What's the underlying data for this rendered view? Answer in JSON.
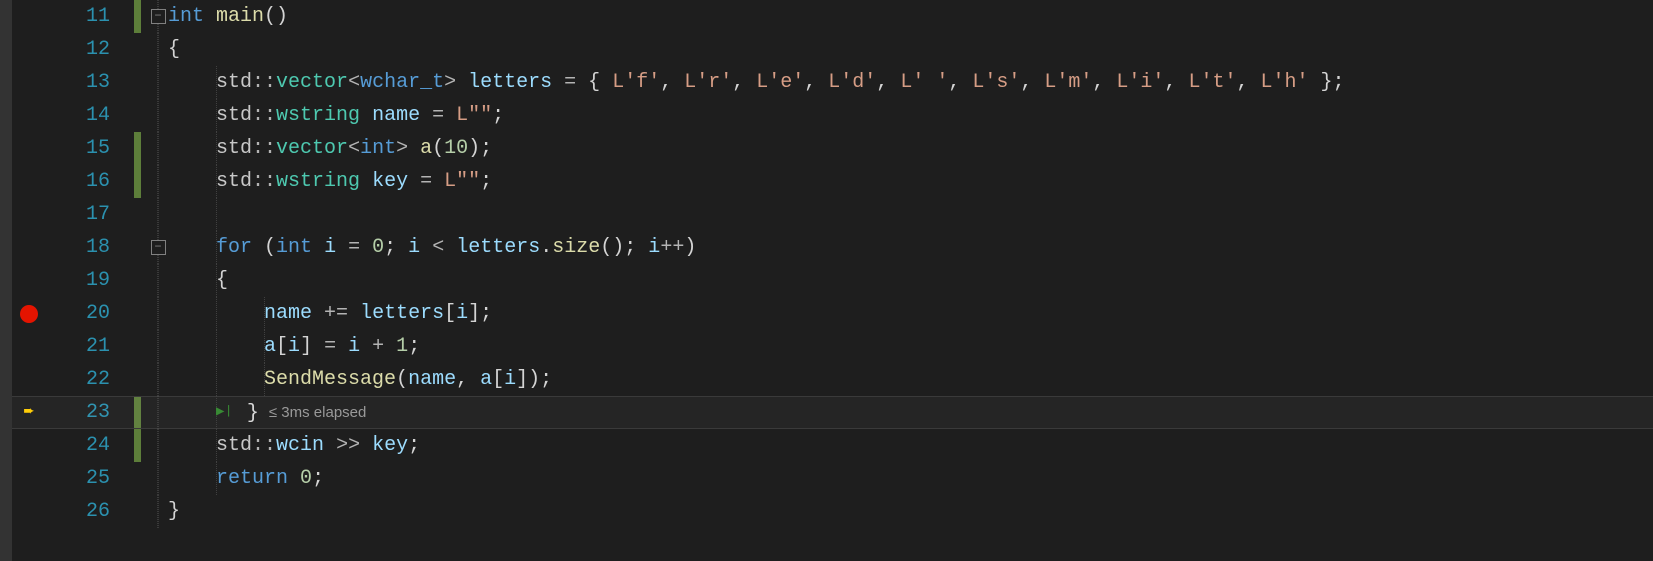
{
  "lines": [
    {
      "num": 11,
      "change": true,
      "fold": "minus",
      "bp": null
    },
    {
      "num": 12,
      "change": false,
      "fold": null,
      "bp": null
    },
    {
      "num": 13,
      "change": false,
      "fold": null,
      "bp": null
    },
    {
      "num": 14,
      "change": false,
      "fold": null,
      "bp": null
    },
    {
      "num": 15,
      "change": true,
      "fold": null,
      "bp": null
    },
    {
      "num": 16,
      "change": true,
      "fold": null,
      "bp": null
    },
    {
      "num": 17,
      "change": false,
      "fold": null,
      "bp": null
    },
    {
      "num": 18,
      "change": false,
      "fold": "minus",
      "bp": null
    },
    {
      "num": 19,
      "change": false,
      "fold": null,
      "bp": null
    },
    {
      "num": 20,
      "change": false,
      "fold": null,
      "bp": "breakpoint"
    },
    {
      "num": 21,
      "change": false,
      "fold": null,
      "bp": null
    },
    {
      "num": 22,
      "change": false,
      "fold": null,
      "bp": null
    },
    {
      "num": 23,
      "change": true,
      "fold": null,
      "bp": "current"
    },
    {
      "num": 24,
      "change": true,
      "fold": null,
      "bp": null
    },
    {
      "num": 25,
      "change": false,
      "fold": null,
      "bp": null
    },
    {
      "num": 26,
      "change": false,
      "fold": null,
      "bp": null
    }
  ],
  "codelens": {
    "elapsed": "≤ 3ms elapsed"
  },
  "code": {
    "l11": [
      [
        "keyword",
        "int"
      ],
      [
        "punc",
        " "
      ],
      [
        "func",
        "main"
      ],
      [
        "punc",
        "()"
      ]
    ],
    "l12": [
      [
        "punc",
        "{"
      ]
    ],
    "l13": [
      [
        "punc",
        "    "
      ],
      [
        "ns",
        "std"
      ],
      [
        "op",
        "::"
      ],
      [
        "class",
        "vector"
      ],
      [
        "op",
        "<"
      ],
      [
        "keyword",
        "wchar_t"
      ],
      [
        "op",
        ">"
      ],
      [
        "punc",
        " "
      ],
      [
        "var",
        "letters"
      ],
      [
        "punc",
        " "
      ],
      [
        "op",
        "="
      ],
      [
        "punc",
        " { "
      ],
      [
        "string",
        "L'f'"
      ],
      [
        "punc",
        ", "
      ],
      [
        "string",
        "L'r'"
      ],
      [
        "punc",
        ", "
      ],
      [
        "string",
        "L'e'"
      ],
      [
        "punc",
        ", "
      ],
      [
        "string",
        "L'd'"
      ],
      [
        "punc",
        ", "
      ],
      [
        "string",
        "L' '"
      ],
      [
        "punc",
        ", "
      ],
      [
        "string",
        "L's'"
      ],
      [
        "punc",
        ", "
      ],
      [
        "string",
        "L'm'"
      ],
      [
        "punc",
        ", "
      ],
      [
        "string",
        "L'i'"
      ],
      [
        "punc",
        ", "
      ],
      [
        "string",
        "L't'"
      ],
      [
        "punc",
        ", "
      ],
      [
        "string",
        "L'h'"
      ],
      [
        "punc",
        " };"
      ]
    ],
    "l14": [
      [
        "punc",
        "    "
      ],
      [
        "ns",
        "std"
      ],
      [
        "op",
        "::"
      ],
      [
        "class",
        "wstring"
      ],
      [
        "punc",
        " "
      ],
      [
        "var",
        "name"
      ],
      [
        "punc",
        " "
      ],
      [
        "op",
        "="
      ],
      [
        "punc",
        " "
      ],
      [
        "string",
        "L\"\""
      ],
      [
        "punc",
        ";"
      ]
    ],
    "l15": [
      [
        "punc",
        "    "
      ],
      [
        "ns",
        "std"
      ],
      [
        "op",
        "::"
      ],
      [
        "class",
        "vector"
      ],
      [
        "op",
        "<"
      ],
      [
        "keyword",
        "int"
      ],
      [
        "op",
        ">"
      ],
      [
        "punc",
        " "
      ],
      [
        "func",
        "a"
      ],
      [
        "punc",
        "("
      ],
      [
        "number",
        "10"
      ],
      [
        "punc",
        ");"
      ]
    ],
    "l16": [
      [
        "punc",
        "    "
      ],
      [
        "ns",
        "std"
      ],
      [
        "op",
        "::"
      ],
      [
        "class",
        "wstring"
      ],
      [
        "punc",
        " "
      ],
      [
        "var",
        "key"
      ],
      [
        "punc",
        " "
      ],
      [
        "op",
        "="
      ],
      [
        "punc",
        " "
      ],
      [
        "string",
        "L\"\""
      ],
      [
        "punc",
        ";"
      ]
    ],
    "l17": [],
    "l18": [
      [
        "punc",
        "    "
      ],
      [
        "keyword",
        "for"
      ],
      [
        "punc",
        " ("
      ],
      [
        "keyword",
        "int"
      ],
      [
        "punc",
        " "
      ],
      [
        "var",
        "i"
      ],
      [
        "punc",
        " "
      ],
      [
        "op",
        "="
      ],
      [
        "punc",
        " "
      ],
      [
        "number",
        "0"
      ],
      [
        "punc",
        "; "
      ],
      [
        "var",
        "i"
      ],
      [
        "punc",
        " "
      ],
      [
        "op",
        "<"
      ],
      [
        "punc",
        " "
      ],
      [
        "var",
        "letters"
      ],
      [
        "punc",
        "."
      ],
      [
        "func",
        "size"
      ],
      [
        "punc",
        "(); "
      ],
      [
        "var",
        "i"
      ],
      [
        "op",
        "++"
      ],
      [
        "punc",
        ")"
      ]
    ],
    "l19": [
      [
        "punc",
        "    {"
      ]
    ],
    "l20": [
      [
        "punc",
        "        "
      ],
      [
        "var",
        "name"
      ],
      [
        "punc",
        " "
      ],
      [
        "op",
        "+="
      ],
      [
        "punc",
        " "
      ],
      [
        "var",
        "letters"
      ],
      [
        "punc",
        "["
      ],
      [
        "var",
        "i"
      ],
      [
        "punc",
        "];"
      ]
    ],
    "l21": [
      [
        "punc",
        "        "
      ],
      [
        "var",
        "a"
      ],
      [
        "punc",
        "["
      ],
      [
        "var",
        "i"
      ],
      [
        "punc",
        "] "
      ],
      [
        "op",
        "="
      ],
      [
        "punc",
        " "
      ],
      [
        "var",
        "i"
      ],
      [
        "punc",
        " "
      ],
      [
        "op",
        "+"
      ],
      [
        "punc",
        " "
      ],
      [
        "number",
        "1"
      ],
      [
        "punc",
        ";"
      ]
    ],
    "l22": [
      [
        "punc",
        "        "
      ],
      [
        "func",
        "SendMessage"
      ],
      [
        "punc",
        "("
      ],
      [
        "var",
        "name"
      ],
      [
        "punc",
        ", "
      ],
      [
        "var",
        "a"
      ],
      [
        "punc",
        "["
      ],
      [
        "var",
        "i"
      ],
      [
        "punc",
        "]);"
      ]
    ],
    "l23": [
      [
        "punc",
        "    "
      ],
      [
        "white",
        "}"
      ]
    ],
    "l24": [
      [
        "punc",
        "    "
      ],
      [
        "ns",
        "std"
      ],
      [
        "op",
        "::"
      ],
      [
        "var",
        "wcin"
      ],
      [
        "punc",
        " "
      ],
      [
        "op",
        ">>"
      ],
      [
        "punc",
        " "
      ],
      [
        "var",
        "key"
      ],
      [
        "punc",
        ";"
      ]
    ],
    "l25": [
      [
        "punc",
        "    "
      ],
      [
        "keyword",
        "return"
      ],
      [
        "punc",
        " "
      ],
      [
        "number",
        "0"
      ],
      [
        "punc",
        ";"
      ]
    ],
    "l26": [
      [
        "punc",
        "}"
      ]
    ]
  }
}
